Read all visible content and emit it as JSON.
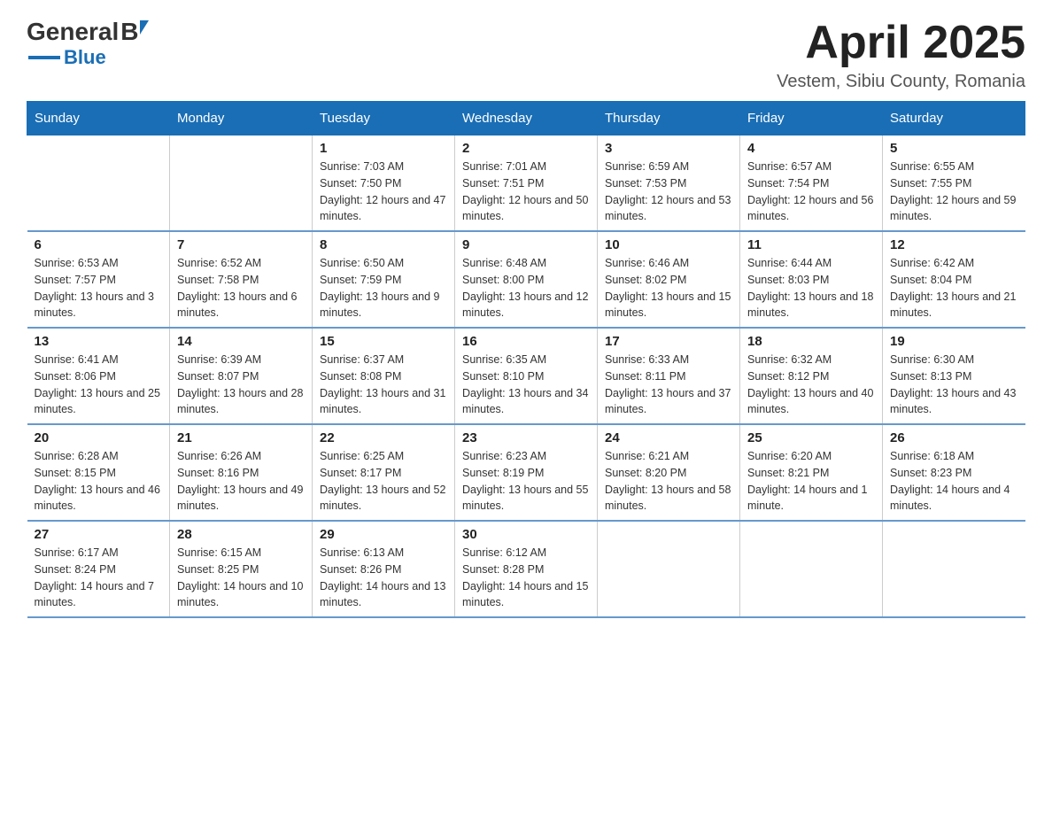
{
  "logo": {
    "general": "General",
    "triangle": "▶",
    "blue": "Blue"
  },
  "header": {
    "title": "April 2025",
    "location": "Vestem, Sibiu County, Romania"
  },
  "days_of_week": [
    "Sunday",
    "Monday",
    "Tuesday",
    "Wednesday",
    "Thursday",
    "Friday",
    "Saturday"
  ],
  "weeks": [
    [
      {
        "day": "",
        "sunrise": "",
        "sunset": "",
        "daylight": ""
      },
      {
        "day": "",
        "sunrise": "",
        "sunset": "",
        "daylight": ""
      },
      {
        "day": "1",
        "sunrise": "Sunrise: 7:03 AM",
        "sunset": "Sunset: 7:50 PM",
        "daylight": "Daylight: 12 hours and 47 minutes."
      },
      {
        "day": "2",
        "sunrise": "Sunrise: 7:01 AM",
        "sunset": "Sunset: 7:51 PM",
        "daylight": "Daylight: 12 hours and 50 minutes."
      },
      {
        "day": "3",
        "sunrise": "Sunrise: 6:59 AM",
        "sunset": "Sunset: 7:53 PM",
        "daylight": "Daylight: 12 hours and 53 minutes."
      },
      {
        "day": "4",
        "sunrise": "Sunrise: 6:57 AM",
        "sunset": "Sunset: 7:54 PM",
        "daylight": "Daylight: 12 hours and 56 minutes."
      },
      {
        "day": "5",
        "sunrise": "Sunrise: 6:55 AM",
        "sunset": "Sunset: 7:55 PM",
        "daylight": "Daylight: 12 hours and 59 minutes."
      }
    ],
    [
      {
        "day": "6",
        "sunrise": "Sunrise: 6:53 AM",
        "sunset": "Sunset: 7:57 PM",
        "daylight": "Daylight: 13 hours and 3 minutes."
      },
      {
        "day": "7",
        "sunrise": "Sunrise: 6:52 AM",
        "sunset": "Sunset: 7:58 PM",
        "daylight": "Daylight: 13 hours and 6 minutes."
      },
      {
        "day": "8",
        "sunrise": "Sunrise: 6:50 AM",
        "sunset": "Sunset: 7:59 PM",
        "daylight": "Daylight: 13 hours and 9 minutes."
      },
      {
        "day": "9",
        "sunrise": "Sunrise: 6:48 AM",
        "sunset": "Sunset: 8:00 PM",
        "daylight": "Daylight: 13 hours and 12 minutes."
      },
      {
        "day": "10",
        "sunrise": "Sunrise: 6:46 AM",
        "sunset": "Sunset: 8:02 PM",
        "daylight": "Daylight: 13 hours and 15 minutes."
      },
      {
        "day": "11",
        "sunrise": "Sunrise: 6:44 AM",
        "sunset": "Sunset: 8:03 PM",
        "daylight": "Daylight: 13 hours and 18 minutes."
      },
      {
        "day": "12",
        "sunrise": "Sunrise: 6:42 AM",
        "sunset": "Sunset: 8:04 PM",
        "daylight": "Daylight: 13 hours and 21 minutes."
      }
    ],
    [
      {
        "day": "13",
        "sunrise": "Sunrise: 6:41 AM",
        "sunset": "Sunset: 8:06 PM",
        "daylight": "Daylight: 13 hours and 25 minutes."
      },
      {
        "day": "14",
        "sunrise": "Sunrise: 6:39 AM",
        "sunset": "Sunset: 8:07 PM",
        "daylight": "Daylight: 13 hours and 28 minutes."
      },
      {
        "day": "15",
        "sunrise": "Sunrise: 6:37 AM",
        "sunset": "Sunset: 8:08 PM",
        "daylight": "Daylight: 13 hours and 31 minutes."
      },
      {
        "day": "16",
        "sunrise": "Sunrise: 6:35 AM",
        "sunset": "Sunset: 8:10 PM",
        "daylight": "Daylight: 13 hours and 34 minutes."
      },
      {
        "day": "17",
        "sunrise": "Sunrise: 6:33 AM",
        "sunset": "Sunset: 8:11 PM",
        "daylight": "Daylight: 13 hours and 37 minutes."
      },
      {
        "day": "18",
        "sunrise": "Sunrise: 6:32 AM",
        "sunset": "Sunset: 8:12 PM",
        "daylight": "Daylight: 13 hours and 40 minutes."
      },
      {
        "day": "19",
        "sunrise": "Sunrise: 6:30 AM",
        "sunset": "Sunset: 8:13 PM",
        "daylight": "Daylight: 13 hours and 43 minutes."
      }
    ],
    [
      {
        "day": "20",
        "sunrise": "Sunrise: 6:28 AM",
        "sunset": "Sunset: 8:15 PM",
        "daylight": "Daylight: 13 hours and 46 minutes."
      },
      {
        "day": "21",
        "sunrise": "Sunrise: 6:26 AM",
        "sunset": "Sunset: 8:16 PM",
        "daylight": "Daylight: 13 hours and 49 minutes."
      },
      {
        "day": "22",
        "sunrise": "Sunrise: 6:25 AM",
        "sunset": "Sunset: 8:17 PM",
        "daylight": "Daylight: 13 hours and 52 minutes."
      },
      {
        "day": "23",
        "sunrise": "Sunrise: 6:23 AM",
        "sunset": "Sunset: 8:19 PM",
        "daylight": "Daylight: 13 hours and 55 minutes."
      },
      {
        "day": "24",
        "sunrise": "Sunrise: 6:21 AM",
        "sunset": "Sunset: 8:20 PM",
        "daylight": "Daylight: 13 hours and 58 minutes."
      },
      {
        "day": "25",
        "sunrise": "Sunrise: 6:20 AM",
        "sunset": "Sunset: 8:21 PM",
        "daylight": "Daylight: 14 hours and 1 minute."
      },
      {
        "day": "26",
        "sunrise": "Sunrise: 6:18 AM",
        "sunset": "Sunset: 8:23 PM",
        "daylight": "Daylight: 14 hours and 4 minutes."
      }
    ],
    [
      {
        "day": "27",
        "sunrise": "Sunrise: 6:17 AM",
        "sunset": "Sunset: 8:24 PM",
        "daylight": "Daylight: 14 hours and 7 minutes."
      },
      {
        "day": "28",
        "sunrise": "Sunrise: 6:15 AM",
        "sunset": "Sunset: 8:25 PM",
        "daylight": "Daylight: 14 hours and 10 minutes."
      },
      {
        "day": "29",
        "sunrise": "Sunrise: 6:13 AM",
        "sunset": "Sunset: 8:26 PM",
        "daylight": "Daylight: 14 hours and 13 minutes."
      },
      {
        "day": "30",
        "sunrise": "Sunrise: 6:12 AM",
        "sunset": "Sunset: 8:28 PM",
        "daylight": "Daylight: 14 hours and 15 minutes."
      },
      {
        "day": "",
        "sunrise": "",
        "sunset": "",
        "daylight": ""
      },
      {
        "day": "",
        "sunrise": "",
        "sunset": "",
        "daylight": ""
      },
      {
        "day": "",
        "sunrise": "",
        "sunset": "",
        "daylight": ""
      }
    ]
  ]
}
